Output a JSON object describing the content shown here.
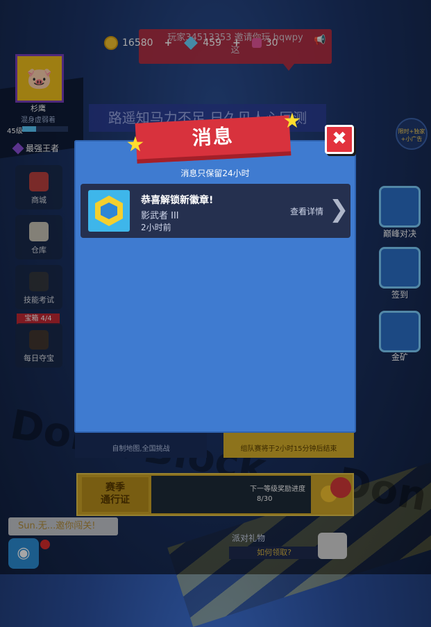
{
  "hud": {
    "coins": "16580",
    "gems": "459",
    "tickets": "30",
    "plus": "+"
  },
  "invite_banner": {
    "line1": "玩家34513353 邀请你玩 hqwpy",
    "line2": "这"
  },
  "profile": {
    "name": "杉鹰",
    "subtitle": "混身虚弱着",
    "level": "45级",
    "level_progress": 0.3,
    "rank": "最强王者"
  },
  "quote_banner": "路遥知马力不足,日久见人心叵测",
  "left_menu": [
    {
      "label": "商城",
      "icon": "shop-icon"
    },
    {
      "label": "仓库",
      "icon": "warehouse-icon"
    },
    {
      "label": "技能考试",
      "icon": "exam-icon"
    },
    {
      "label": "每日夺宝",
      "icon": "treasure-icon"
    }
  ],
  "treasure_tag": "宝箱 4/4",
  "right_menu": [
    {
      "label": "巅峰对决",
      "icon": "tv-icon"
    },
    {
      "label": "签到",
      "icon": "calendar-icon"
    },
    {
      "label": "金矿",
      "icon": "gold-mine-icon"
    }
  ],
  "corner_badge": "限时+独家\n+小广告",
  "bottom_cards": {
    "left": "自制地图,全国挑战",
    "right": "组队赛将于2小时15分钟后结束"
  },
  "season": {
    "pass_label_1": "赛季",
    "pass_label_2": "通行证",
    "next_label": "下一等级奖励进度",
    "progress": "8/30"
  },
  "chat": {
    "bubble": "Sun.无...邀你闯关!"
  },
  "party": {
    "title": "派对礼物",
    "how": "如何领取?"
  },
  "background_text": "Don't Block ... Don't",
  "modal": {
    "title": "消息",
    "close_symbol": "✖",
    "retention_note": "消息只保留24小时",
    "messages": [
      {
        "title": "恭喜解锁新徽章!",
        "badge": "影武者 III",
        "time": "2小时前",
        "action": "查看详情"
      }
    ]
  },
  "colors": {
    "modal_bg": "#3f7bd0",
    "ribbon": "#d8323d",
    "card": "#25304f",
    "star": "#ffdd2e"
  }
}
